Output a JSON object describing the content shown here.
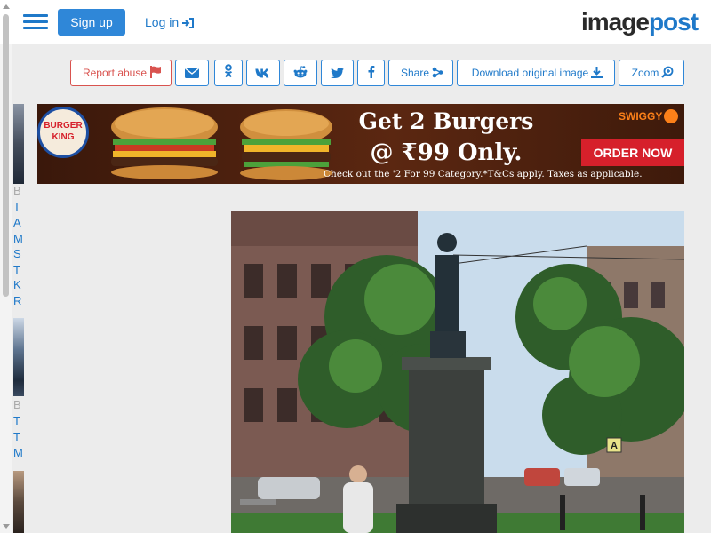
{
  "header": {
    "logo": {
      "part_image": "image",
      "part_post": "post"
    },
    "login_label": "Log in",
    "signup_label": "Sign up",
    "menu_icon": "hamburger-menu-icon"
  },
  "toolbar": {
    "zoom": "Zoom",
    "download": "Download original image",
    "share": "Share",
    "report": "Report abuse",
    "social_icons": [
      "facebook-icon",
      "twitter-icon",
      "reddit-icon",
      "vk-icon",
      "odnoklassniki-icon",
      "email-icon"
    ]
  },
  "sidebar": {
    "words": [
      "B",
      "T",
      "A",
      "M",
      "S",
      "T",
      "K",
      "R",
      "B",
      "T",
      "T",
      "M"
    ]
  },
  "ad": {
    "headline": "Get 2 Burgers",
    "price": "@ ₹99 Only.",
    "fine_print": "Check out the '2 For 99 Category.*T&Cs apply. Taxes as applicable.",
    "cta": "ORDER NOW",
    "brand": "SWIGGY",
    "logo_text": "BURGER KING"
  },
  "photo": {
    "street_sign": "A"
  },
  "colors": {
    "accent": "#2f87d8",
    "link": "#1f79c9",
    "danger": "#d9534f",
    "background": "#ececec",
    "header_bg": "#ffffff"
  }
}
